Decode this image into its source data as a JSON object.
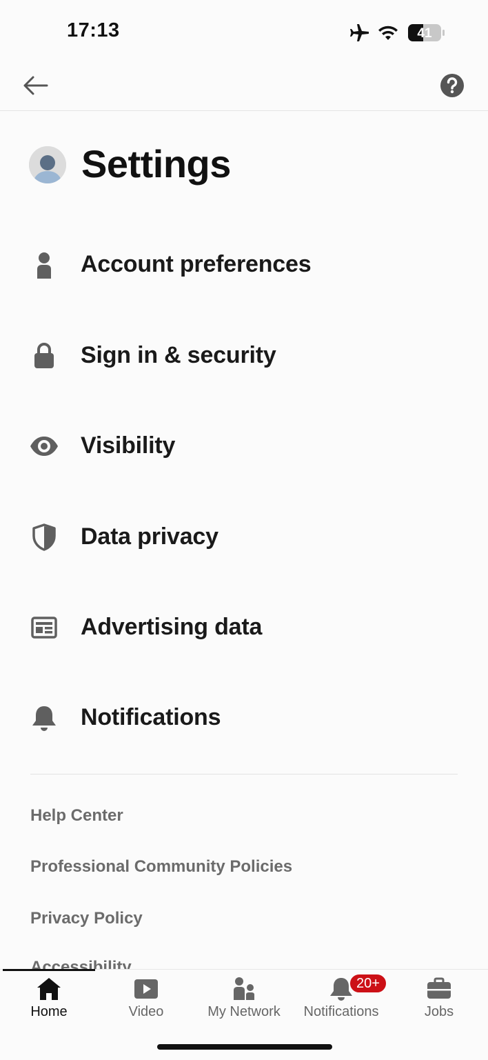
{
  "status_bar": {
    "time": "17:13",
    "battery": "41",
    "icons": [
      "airplane-icon",
      "wifi-icon",
      "battery-icon"
    ]
  },
  "top_bar": {
    "icons": [
      "back-arrow-icon",
      "help-icon"
    ]
  },
  "page": {
    "title": "Settings"
  },
  "settings": [
    {
      "label": "Account preferences",
      "icon": "person-icon"
    },
    {
      "label": "Sign in & security",
      "icon": "lock-icon"
    },
    {
      "label": "Visibility",
      "icon": "eye-icon"
    },
    {
      "label": "Data privacy",
      "icon": "shield-icon"
    },
    {
      "label": "Advertising data",
      "icon": "ad-icon"
    },
    {
      "label": "Notifications",
      "icon": "bell-icon"
    }
  ],
  "footer_links": [
    "Help Center",
    "Professional Community Policies",
    "Privacy Policy",
    "Accessibility"
  ],
  "bottom_nav": {
    "items": [
      {
        "label": "Home",
        "icon": "home-icon",
        "active": true
      },
      {
        "label": "Video",
        "icon": "video-icon"
      },
      {
        "label": "My Network",
        "icon": "network-icon"
      },
      {
        "label": "Notifications",
        "icon": "bell-icon"
      },
      {
        "label": "Jobs",
        "icon": "briefcase-icon"
      }
    ],
    "notifications_badge": "20+"
  },
  "colors": {
    "background": "#fbfbfb",
    "text": "#1a1a1a",
    "icon_gray": "#5f5f5f",
    "link_gray": "#6b6b6b",
    "badge_red": "#cc1016"
  }
}
